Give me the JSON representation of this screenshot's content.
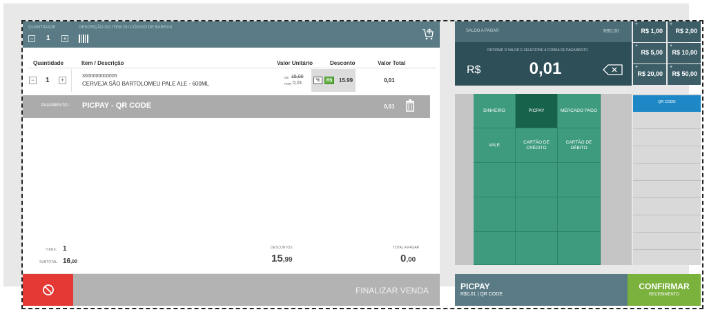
{
  "header": {
    "qty_label": "QUANTIDADE",
    "qty_value": "1",
    "desc_label": "DESCRIÇÃO DO ITEM OU CÓDIGO DE BARRAS"
  },
  "table": {
    "col_qty": "Quantidade",
    "col_desc": "Item / Descrição",
    "col_unit": "Valor Unitário",
    "col_disc": "Desconto",
    "col_total": "Valor Total"
  },
  "item": {
    "qty": "1",
    "code": "3000000000005",
    "name": "CERVEJA SÃO BARTOLOMEU PALE ALE - 600ML",
    "de_label": "DE",
    "de_value": "15,00",
    "por_label": "POR",
    "por_value": "0,01",
    "pct_label": "%",
    "rs_label": "R$",
    "discount": "15.99",
    "total": "0,01"
  },
  "payment_row": {
    "label": "PAGAMENTO :",
    "method": "PICPAY  - QR CODE",
    "value": "0,01"
  },
  "footer": {
    "items_label": "ITENS:",
    "items_value": "1",
    "subtotal_label": "SUBTOTAL:",
    "subtotal_int": "16",
    "subtotal_dec": ",00",
    "discounts_label": "DESCONTOS",
    "discounts_int": "15",
    "discounts_dec": ",99",
    "total_label": "TOTAL A PAGAR",
    "total_int": "0",
    "total_dec": ",00"
  },
  "actions": {
    "finalizar": "FINALIZAR VENDA"
  },
  "saldo": {
    "label": "SALDO A PAGAR",
    "value": "R$0,00",
    "hint": "INFORME O VALOR E SELECIONE A FORMA DE PAGAMENTO",
    "currency": "R$",
    "amount": "0,01"
  },
  "quick_amounts": [
    {
      "plus": "+",
      "label": "R$ 1,00"
    },
    {
      "plus": "+",
      "label": "R$ 2,00"
    },
    {
      "plus": "+",
      "label": "R$ 5,00"
    },
    {
      "plus": "+",
      "label": "R$ 10,00"
    },
    {
      "plus": "+",
      "label": "R$ 20,00"
    },
    {
      "plus": "+",
      "label": "R$ 50,00"
    }
  ],
  "payment_methods": [
    {
      "label": "DINHEIRO"
    },
    {
      "label": "PICPAY"
    },
    {
      "label": "MERCADO PAGO"
    },
    {
      "label": "VALE"
    },
    {
      "label": "CARTÃO DE CRÉDITO"
    },
    {
      "label": "CARTÃO DE DÉBITO"
    }
  ],
  "sub_method": "QR CODE",
  "selected": {
    "title": "PICPAY",
    "subtitle": "R$0,01 | QR CODE"
  },
  "confirm": {
    "title": "CONFIRMAR",
    "subtitle": "RECEBIMENTO"
  },
  "colors": {
    "header": "#5a7b85",
    "green_grid": "#3e9b7d",
    "selected_cell": "#17624a",
    "confirm": "#7bb23e",
    "cancel": "#e53935",
    "qr_tab": "#1e88c7"
  }
}
